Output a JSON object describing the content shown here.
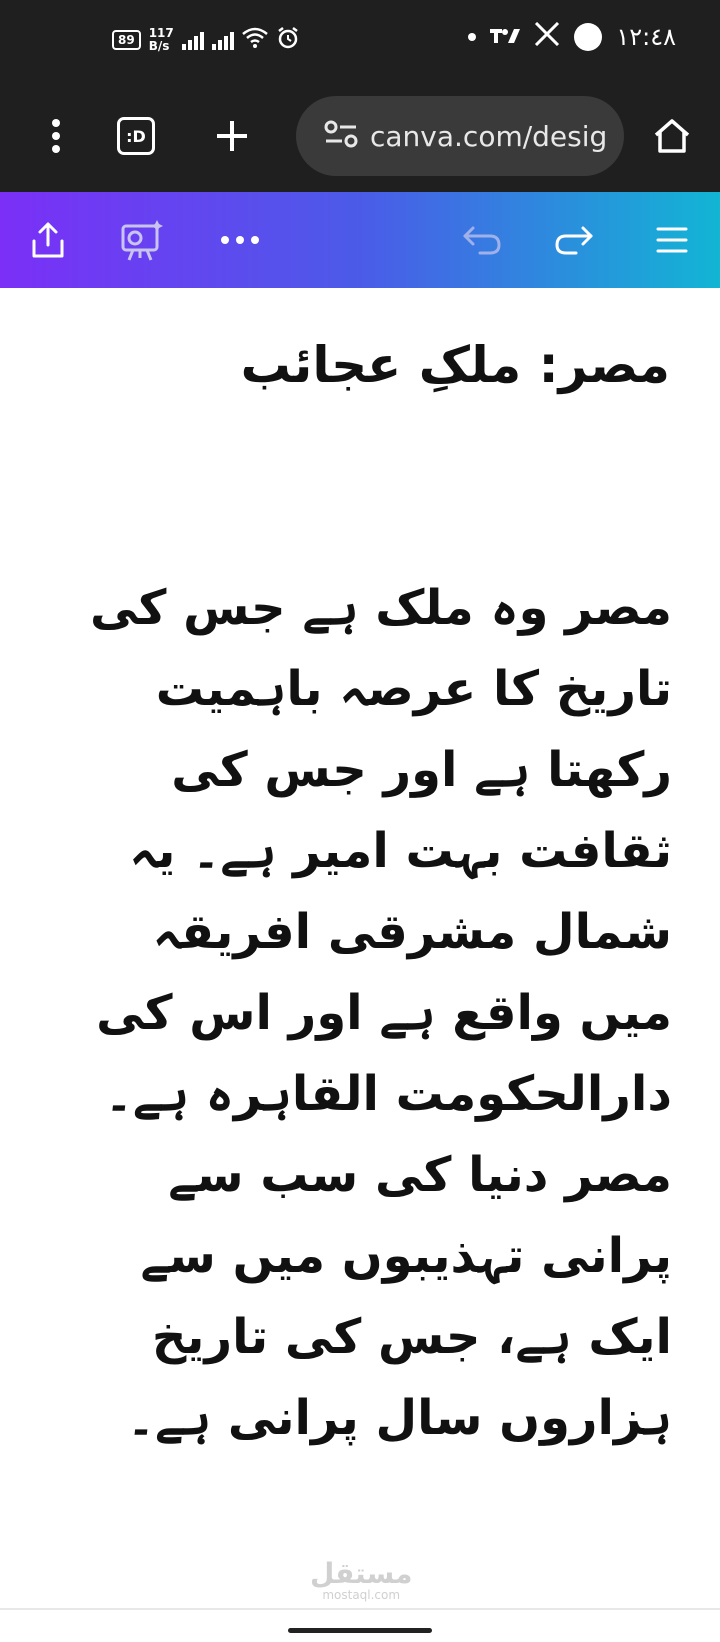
{
  "status_bar": {
    "battery": "89",
    "speed_value": "117",
    "speed_unit": "B/s",
    "time": "١٢:٤٨",
    "icons": [
      "battery-icon",
      "signal-icon",
      "signal-icon",
      "wifi-icon",
      "alarm-icon",
      "dot-icon",
      "trading-app-icon",
      "x-app-icon",
      "circle-icon"
    ]
  },
  "browser": {
    "url": "canva.com/desig",
    "tab_icon_text": ":D",
    "icons": [
      "menu-dots-icon",
      "tabs-icon",
      "plus-icon",
      "site-settings-icon",
      "home-icon"
    ]
  },
  "canva_toolbar": {
    "icons": [
      "share-icon",
      "present-icon",
      "more-icon",
      "undo-icon",
      "redo-icon",
      "menu-icon"
    ],
    "colors": {
      "start": "#7b2ff7",
      "end": "#12b5d4"
    }
  },
  "document": {
    "title": "مصر: ملکِ عجائب",
    "lines": [
      "مصر وہ ملک ہے جس کی",
      "تاریخ کا عرصہ باہمیت",
      "رکھتا ہے اور جس کی",
      "ثقافت بہت امیر ہے۔ یہ",
      "شمال مشرقی افریقہ",
      "میں واقع ہے اور اس کی",
      "دارالحکومت القاہرہ ہے۔",
      "مصر دنیا کی سب سے",
      "پرانی تہذیبوں میں سے",
      "ایک ہے، جس کی تاریخ",
      "ہزاروں سال پرانی ہے۔"
    ]
  },
  "watermark": {
    "arabic": "مستقل",
    "latin": "mostaql.com"
  }
}
